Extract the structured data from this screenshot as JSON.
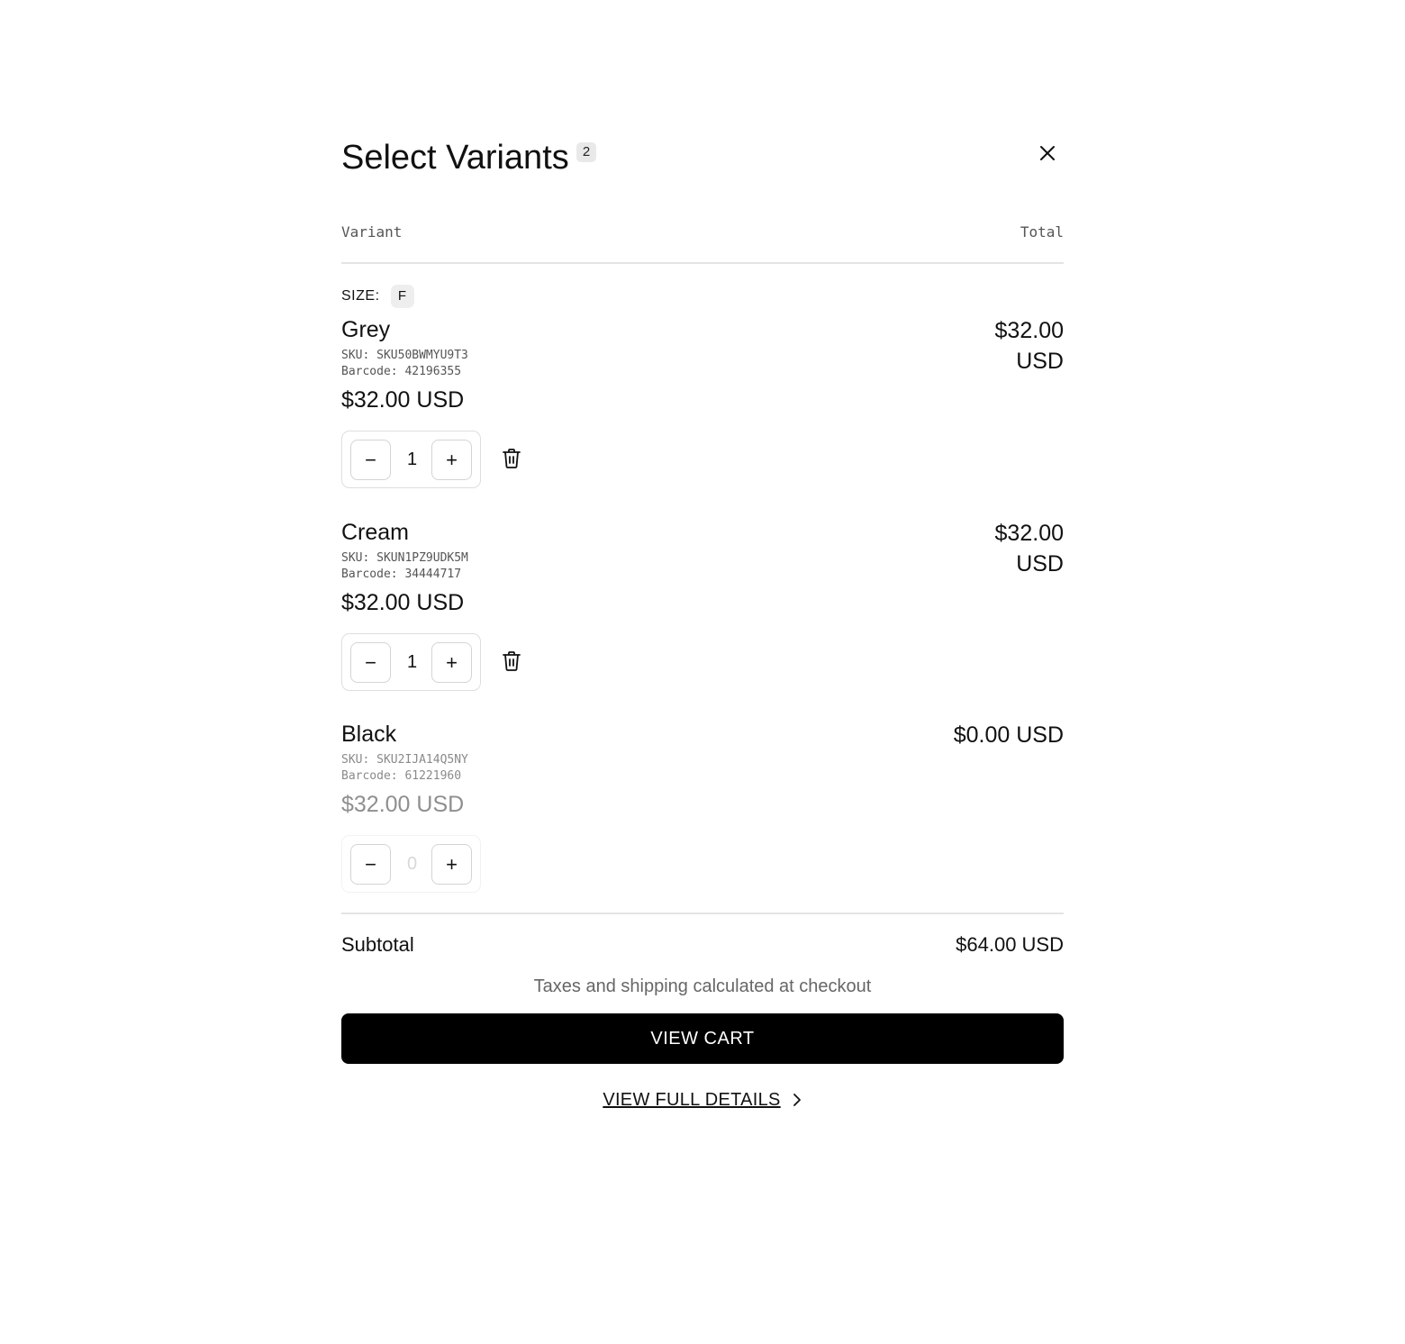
{
  "header": {
    "title": "Select Variants",
    "count_badge": "2"
  },
  "columns": {
    "variant": "Variant",
    "total": "Total"
  },
  "option": {
    "label": "SIZE:",
    "value": "F"
  },
  "variants": [
    {
      "name": "Grey",
      "sku": "SKU: SKU50BWMYU9T3",
      "barcode": "Barcode: 42196355",
      "price": "$32.00 USD",
      "quantity": "1",
      "total_line1": "$32.00",
      "total_line2": "USD"
    },
    {
      "name": "Cream",
      "sku": "SKU: SKUN1PZ9UDK5M",
      "barcode": "Barcode: 34444717",
      "price": "$32.00 USD",
      "quantity": "1",
      "total_line1": "$32.00",
      "total_line2": "USD"
    },
    {
      "name": "Black",
      "sku": "SKU: SKU2IJA14Q5NY",
      "barcode": "Barcode: 61221960",
      "price": "$32.00 USD",
      "quantity": "0",
      "total": "$0.00 USD"
    }
  ],
  "stepper": {
    "minus_symbol": "−",
    "plus_symbol": "+"
  },
  "summary": {
    "subtotal_label": "Subtotal",
    "subtotal_value": "$64.00 USD",
    "tax_note": "Taxes and shipping calculated at checkout"
  },
  "actions": {
    "view_cart": "VIEW CART",
    "view_details": "VIEW FULL DETAILS"
  },
  "icons": {
    "close": "close-icon",
    "delete": "trash-icon",
    "details": "chevron-right-icon"
  }
}
